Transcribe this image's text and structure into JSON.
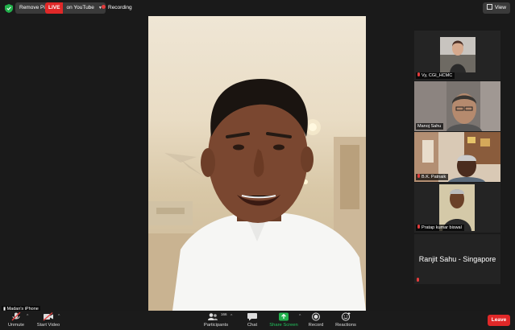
{
  "topbar": {
    "remove_pin": "Remove Pin",
    "live_badge": "LIVE",
    "live_destination": "on YouTube",
    "recording": "Recording",
    "view": "View"
  },
  "main_video": {
    "participant": "Ranjit Sahu"
  },
  "gallery": [
    {
      "name": "Vy, CGI_HCMC"
    },
    {
      "name": "Manoj Sahu"
    },
    {
      "name": "B.K. Patnaik"
    },
    {
      "name": "Pratap kumar biswal"
    },
    {
      "name": "Ranjit Sahu - Singapore"
    }
  ],
  "self_label": "Madan's iPhone",
  "controls": {
    "unmute": "Unmute",
    "start_video": "Start Video",
    "participants": "Participants",
    "participants_count": "166",
    "chat": "Chat",
    "share_screen": "Share Screen",
    "record": "Record",
    "reactions": "Reactions",
    "leave": "Leave"
  },
  "colors": {
    "accent_green": "#22b14c",
    "live_red": "#e02828",
    "background": "#1a1a1a"
  }
}
